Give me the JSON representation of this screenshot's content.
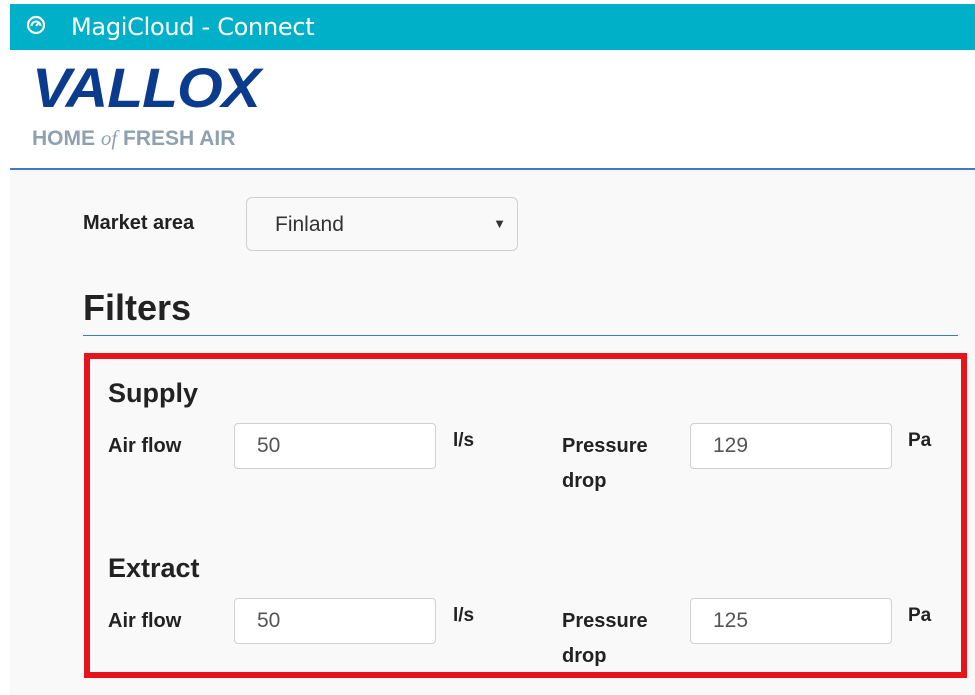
{
  "window": {
    "title": "MagiCloud - Connect",
    "accent_color": "#00b0c8",
    "icon": "magicloud-app-icon"
  },
  "logo": {
    "brand": "VALLOX",
    "tagline_part1": "HOME ",
    "tagline_of": "of",
    "tagline_part2": " FRESH AIR",
    "brand_color": "#0a3b8c"
  },
  "market": {
    "label": "Market area",
    "selected": "Finland",
    "dropdown_icon": "caret-down-icon"
  },
  "filters": {
    "title": "Filters",
    "highlight_color": "#e8141b",
    "supply": {
      "title": "Supply",
      "airflow_label": "Air flow",
      "airflow_value": "50",
      "airflow_unit": "l/s",
      "pressure_label_line1": "Pressure",
      "pressure_label_line2": "drop",
      "pressure_value": "129",
      "pressure_unit": "Pa"
    },
    "extract": {
      "title": "Extract",
      "airflow_label": "Air flow",
      "airflow_value": "50",
      "airflow_unit": "l/s",
      "pressure_label_line1": "Pressure",
      "pressure_label_line2": "drop",
      "pressure_value": "125",
      "pressure_unit": "Pa"
    }
  }
}
